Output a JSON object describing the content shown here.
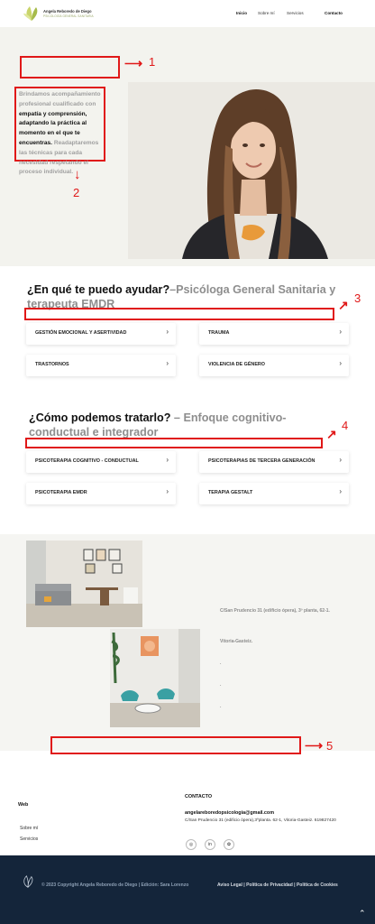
{
  "header": {
    "logo_name": "Angela Reboredo de Diego",
    "logo_sub": "PSICOLOGÍA GENERAL SANITARIA",
    "nav": [
      "Inicio",
      "Sobre mí",
      "Servicios",
      "Contacto"
    ]
  },
  "hero": {
    "text_gray_1": "Brindamos acompañamiento profesional cualificado con ",
    "text_bold_1": "empatía y comprensión, adaptando la práctica al momento en el que te encuentras.",
    "text_gray_2": " Readaptaremos las técnicas para cada necesidad respetando el proceso individual."
  },
  "annotations": [
    "1",
    "2",
    "3",
    "4",
    "5"
  ],
  "help_section": {
    "title": "¿En qué te puedo ayudar?",
    "subtitle": "–Psicóloga General Sanitaria y terapeuta EMDR",
    "cards": [
      "GESTIÓN EMOCIONAL Y ASERTIVIDAD",
      "TRAUMA",
      "TRASTORNOS",
      "VIOLENCIA DE GÉNERO"
    ]
  },
  "treat_section": {
    "title": "¿Cómo podemos tratarlo?",
    "subtitle": " – Enfoque cognitivo-conductual e integrador",
    "cards": [
      "PSICOTERAPIA COGNITIVO - CONDUCTUAL",
      "PSICOTERAPIAS DE TERCERA GENERACIÓN",
      "PSICOTERAPIA EMDR",
      "TERAPIA GESTALT"
    ]
  },
  "office": {
    "address_1": "C/San Prudencio 31 (edificio ópera), 3º planta, 62-1.",
    "city": "Vitoria-Gasteiz.",
    "dots": [
      ".",
      ".",
      "."
    ]
  },
  "footer": {
    "web_heading": "Web",
    "links": [
      "Sobre mí",
      "Servicios"
    ],
    "contact_heading": "CONTACTO",
    "email": "angelareboredopsicologia@gmail.com",
    "address": "C/San Prudencio 31 (edificio ópera),3ºplanta. 62-1, Vitoria-Gasteiz. 619827420",
    "copyright": "© 2023 Copyright Angela Reboredo de Diego | Edición: Sara Lorenzo",
    "legal_1": "Aviso Legal",
    "legal_2": "Política de Privacidad",
    "legal_3": "Política de Cookies",
    "sep": " | "
  },
  "icons": {
    "chevron": "›",
    "instagram": "◎",
    "linkedin": "in",
    "other": "✿",
    "totop": "⌃"
  },
  "colors": {
    "annotation_red": "#e01818",
    "footer_bg": "#14253a",
    "hero_bg": "#f3f3ee"
  }
}
